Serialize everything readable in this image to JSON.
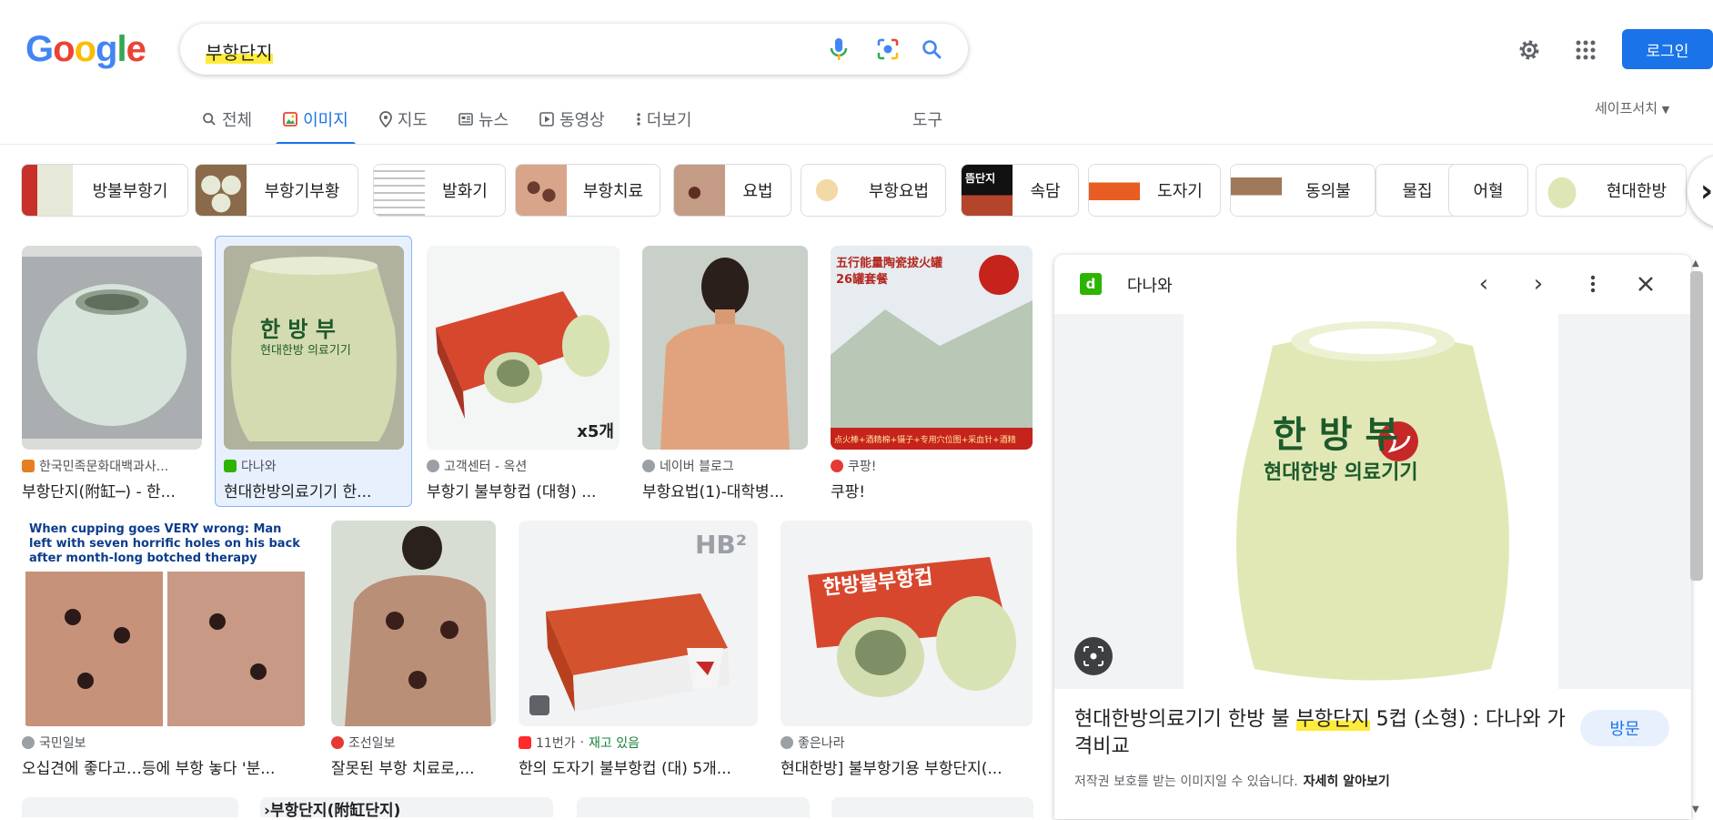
{
  "header": {
    "logo": "Google",
    "search_value": "부항단지",
    "login_label": "로그인"
  },
  "tabs": [
    {
      "label": "전체",
      "icon": "search-icon",
      "active": false
    },
    {
      "label": "이미지",
      "icon": "image-icon",
      "active": true
    },
    {
      "label": "지도",
      "icon": "map-pin-icon",
      "active": false
    },
    {
      "label": "뉴스",
      "icon": "news-icon",
      "active": false
    },
    {
      "label": "동영상",
      "icon": "play-icon",
      "active": false
    },
    {
      "label": "더보기",
      "icon": "more-vertical-icon",
      "active": false
    }
  ],
  "tools_label": "도구",
  "safesearch_label": "세이프서치",
  "chips": [
    {
      "label": "방불부항기",
      "thumb": true
    },
    {
      "label": "부항기부황",
      "thumb": true
    },
    {
      "label": "발화기",
      "thumb": true
    },
    {
      "label": "부항치료",
      "thumb": true
    },
    {
      "label": "요법",
      "thumb": true
    },
    {
      "label": "부항요법",
      "thumb": true
    },
    {
      "label": "속담",
      "thumb": true,
      "thumb_text": "뜸단지"
    },
    {
      "label": "도자기",
      "thumb": true
    },
    {
      "label": "동의불",
      "thumb": true
    },
    {
      "label": "물집",
      "thumb": false
    },
    {
      "label": "어혈",
      "thumb": false
    },
    {
      "label": "현대한방",
      "thumb": true
    }
  ],
  "results_row1": [
    {
      "source": "한국민족문화대백과사...",
      "title": "부항단지(附缸─) - 한...",
      "fav_color": "#e67e22"
    },
    {
      "source": "다나와",
      "title": "현대한방의료기기 한...",
      "fav_color": "#2db400"
    },
    {
      "source": "고객센터 - 옥션",
      "title": "부항기 불부항컵 (대형) ...",
      "fav_color": "#9aa0a6",
      "badge": "x5개"
    },
    {
      "source": "네이버 블로그",
      "title": "부항요법(1)-대학병...",
      "fav_color": "#9aa0a6"
    },
    {
      "source": "쿠팡!",
      "title": "쿠팡!",
      "fav_color": "#e53935"
    }
  ],
  "results_row2": [
    {
      "source": "국민일보",
      "title": "오십견에 좋다고…등에 부항 놓다 '분...",
      "fav_color": "#9aa0a6",
      "overlay_text": "When cupping goes VERY wrong: Man left with seven horrific holes on his back after month-long botched therapy"
    },
    {
      "source": "조선일보",
      "title": "잘못된 부항 치료로,...",
      "fav_color": "#e53935"
    },
    {
      "source": "11번가",
      "title": "한의 도자기 불부항컵 (대) 5개...",
      "fav_color": "#ff2a2a",
      "stock": "재고 있음",
      "overlay_text": "HB²"
    },
    {
      "source": "좋은나라",
      "title": "현대한방] 불부항기용 부항단지(...",
      "fav_color": "#9aa0a6",
      "overlay_text": "한방불부항컵"
    }
  ],
  "row3_partial_text": "›부항단지(附缸단지)",
  "image_texts": {
    "jar_main": "한 방 부",
    "jar_sub": "현대한방 의료기기",
    "coupang_top": "五行能量陶瓷拔火罐",
    "coupang_sub": "26罐套餐",
    "coupang_bottom": "点火棒+酒精棉+镊子+专用穴位图+采血针+酒精"
  },
  "panel": {
    "site": "다나와",
    "site_letter": "d",
    "title_before": "현대한방의료기기 한방 불 ",
    "title_highlight": "부항단지",
    "title_after": " 5컵 (소형) : 다나와 가격비교",
    "visit_label": "방문",
    "copyright": "저작권 보호를 받는 이미지일 수 있습니다.",
    "learn_more": "자세히 알아보기"
  },
  "colors": {
    "accent": "#1a73e8",
    "highlight": "#ffeb3b",
    "jar": "#dfe6b5"
  }
}
